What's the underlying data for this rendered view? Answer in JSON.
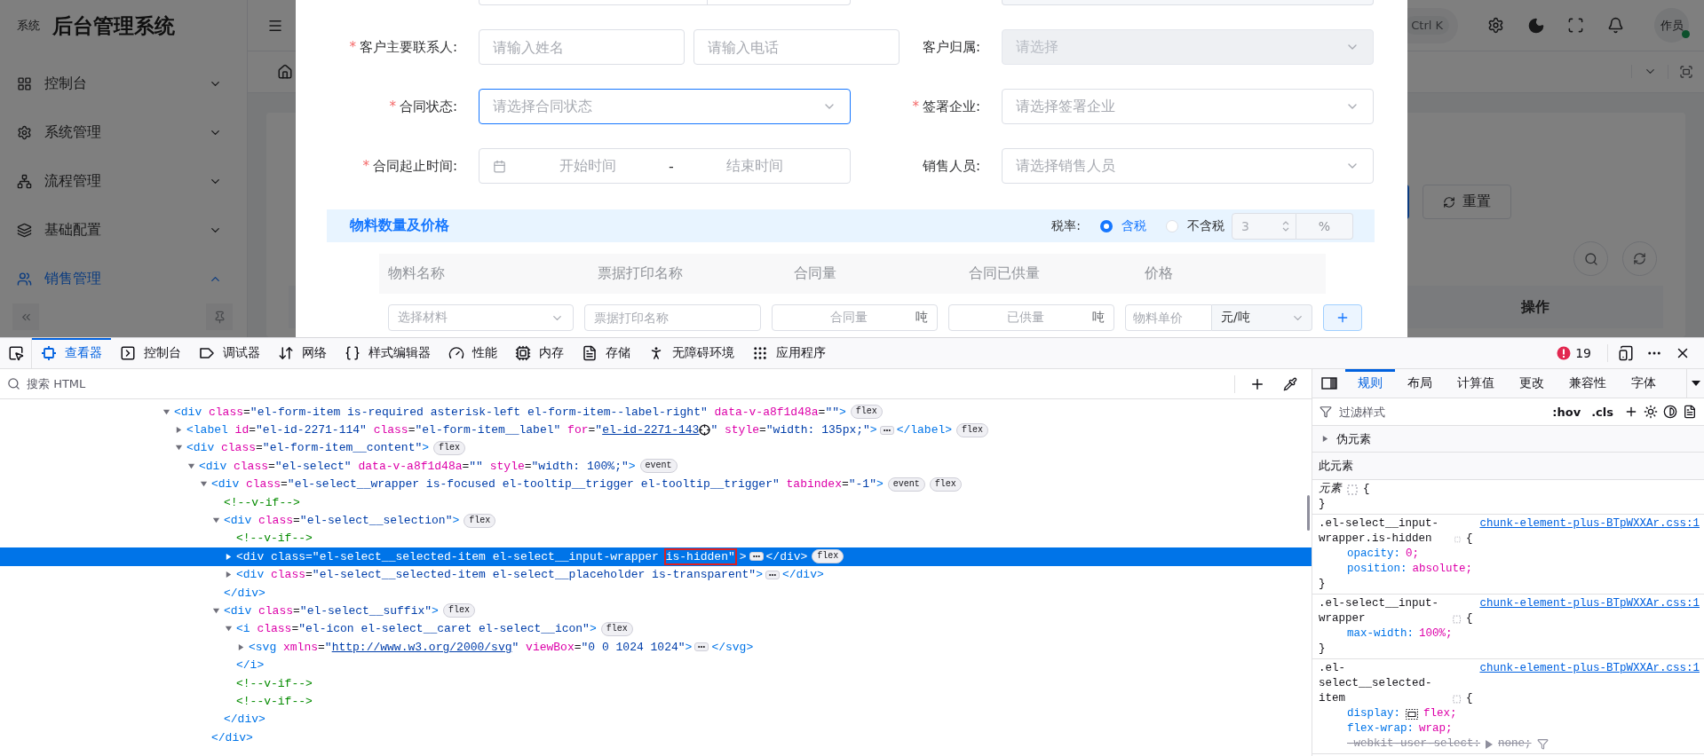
{
  "app": {
    "brand_small": "系统",
    "brand": "后台管理系统",
    "menu": [
      {
        "label": "控制台",
        "expanded": false
      },
      {
        "label": "系统管理",
        "expanded": false
      },
      {
        "label": "流程管理",
        "expanded": false
      },
      {
        "label": "基础配置",
        "expanded": false
      },
      {
        "label": "销售管理",
        "expanded": true
      }
    ],
    "shortcut": "Ctrl K",
    "avatar": "作员",
    "reset_button": "重置",
    "action_column": "操作"
  },
  "dialog": {
    "fields": [
      {
        "asterisk": "*",
        "label": "客户主要联系人:",
        "kind": "pair",
        "placeholders": [
          "请输入姓名",
          "请输入电话"
        ],
        "focused": false,
        "disabled": false
      },
      {
        "label": "客户归属:",
        "kind": "select",
        "placeholder": "请选择",
        "focused": false,
        "disabled": true
      },
      {
        "asterisk": "*",
        "label": "合同状态:",
        "kind": "select",
        "placeholder": "请选择合同状态",
        "focused": true,
        "disabled": false
      },
      {
        "asterisk": "*",
        "label": "签署企业:",
        "kind": "select",
        "placeholder": "请选择签署企业",
        "focused": false,
        "disabled": false
      },
      {
        "asterisk": "*",
        "label": "合同起止时间:",
        "kind": "daterange",
        "start": "开始时间",
        "separator": "-",
        "end": "结束时间",
        "focused": false,
        "disabled": false
      },
      {
        "label": "销售人员:",
        "kind": "select",
        "placeholder": "请选择销售人员",
        "focused": false,
        "disabled": false
      }
    ],
    "section": {
      "title": "物料数量及价格",
      "tax_label": "税率:",
      "options": [
        {
          "label": "含税",
          "selected": true
        },
        {
          "label": "不含税",
          "selected": false
        }
      ],
      "rate": "3",
      "unit": "%"
    },
    "columns": [
      "物料名称",
      "票据打印名称",
      "合同量",
      "合同已供量",
      "价格"
    ],
    "row": {
      "material": "选择材料",
      "print_name": {
        "placeholder": "票据打印名称"
      },
      "quantity": "合同量",
      "quantity_unit": "吨",
      "supplied": "已供量",
      "supplied_unit": "吨",
      "price": {
        "placeholder": "物料单价"
      },
      "price_unit": "元/吨"
    }
  },
  "devtools": {
    "tabs": [
      {
        "label": "查看器",
        "selected": true
      },
      {
        "label": "控制台",
        "selected": false
      },
      {
        "label": "调试器",
        "selected": false
      },
      {
        "label": "网络",
        "selected": false
      },
      {
        "label": "样式编辑器",
        "selected": false
      },
      {
        "label": "性能",
        "selected": false
      },
      {
        "label": "内存",
        "selected": false
      },
      {
        "label": "存储",
        "selected": false
      },
      {
        "label": "无障碍环境",
        "selected": false
      },
      {
        "label": "应用程序",
        "selected": false
      }
    ],
    "error_count": "19",
    "search_placeholder": "搜索 HTML",
    "tree": [
      {
        "kind": "element",
        "selected": false,
        "expanded": true,
        "parts": [
          {
            "kind": "code",
            "tokens": [
              {
                "kind": "tag",
                "text": "<div"
              },
              {
                "kind": "attr",
                "text": " class"
              },
              {
                "kind": "eq",
                "text": "="
              },
              {
                "kind": "value",
                "text": "\"el-form-item is-required asterisk-left el-form-item--label-right\""
              },
              {
                "kind": "attr",
                "text": " data-v-a8f1d48a"
              },
              {
                "kind": "eq",
                "text": "="
              },
              {
                "kind": "value",
                "text": "\"\""
              },
              {
                "kind": "tag",
                "text": ">"
              }
            ]
          },
          {
            "kind": "badge",
            "text": "flex"
          }
        ],
        "children": [
          {
            "kind": "element",
            "selected": false,
            "expanded": false,
            "parts": [
              {
                "kind": "code",
                "tokens": [
                  {
                    "kind": "tag",
                    "text": "<label"
                  },
                  {
                    "kind": "attr",
                    "text": " id"
                  },
                  {
                    "kind": "eq",
                    "text": "="
                  },
                  {
                    "kind": "value",
                    "text": "\"el-id-2271-114\""
                  },
                  {
                    "kind": "attr",
                    "text": " class"
                  },
                  {
                    "kind": "eq",
                    "text": "="
                  },
                  {
                    "kind": "value",
                    "text": "\"el-form-item__label\""
                  },
                  {
                    "kind": "attr",
                    "text": " for"
                  },
                  {
                    "kind": "eq",
                    "text": "="
                  },
                  {
                    "kind": "value",
                    "text": "\""
                  }
                ]
              },
              {
                "kind": "link",
                "text": "el-id-2271-143"
              },
              {
                "kind": "target"
              },
              {
                "kind": "code",
                "tokens": [
                  {
                    "kind": "value",
                    "text": "\""
                  },
                  {
                    "kind": "attr",
                    "text": " style"
                  },
                  {
                    "kind": "eq",
                    "text": "="
                  },
                  {
                    "kind": "value",
                    "text": "\"width: 135px;\""
                  },
                  {
                    "kind": "tag",
                    "text": ">"
                  }
                ]
              },
              {
                "kind": "more"
              },
              {
                "kind": "code",
                "tokens": [
                  {
                    "kind": "tag",
                    "text": "</label>"
                  }
                ]
              },
              {
                "kind": "badge",
                "text": "flex"
              }
            ]
          },
          {
            "kind": "element",
            "selected": false,
            "expanded": true,
            "parts": [
              {
                "kind": "code",
                "tokens": [
                  {
                    "kind": "tag",
                    "text": "<div"
                  },
                  {
                    "kind": "attr",
                    "text": " class"
                  },
                  {
                    "kind": "eq",
                    "text": "="
                  },
                  {
                    "kind": "value",
                    "text": "\"el-form-item__content\""
                  },
                  {
                    "kind": "tag",
                    "text": ">"
                  }
                ]
              },
              {
                "kind": "badge",
                "text": "flex"
              }
            ],
            "children": [
              {
                "kind": "element",
                "selected": false,
                "expanded": true,
                "parts": [
                  {
                    "kind": "code",
                    "tokens": [
                      {
                        "kind": "tag",
                        "text": "<div"
                      },
                      {
                        "kind": "attr",
                        "text": " class"
                      },
                      {
                        "kind": "eq",
                        "text": "="
                      },
                      {
                        "kind": "value",
                        "text": "\"el-select\""
                      },
                      {
                        "kind": "attr",
                        "text": " data-v-a8f1d48a"
                      },
                      {
                        "kind": "eq",
                        "text": "="
                      },
                      {
                        "kind": "value",
                        "text": "\"\""
                      },
                      {
                        "kind": "attr",
                        "text": " style"
                      },
                      {
                        "kind": "eq",
                        "text": "="
                      },
                      {
                        "kind": "value",
                        "text": "\"width: 100%;\""
                      },
                      {
                        "kind": "tag",
                        "text": ">"
                      }
                    ]
                  },
                  {
                    "kind": "badge",
                    "text": "event"
                  }
                ],
                "children": [
                  {
                    "kind": "element",
                    "selected": false,
                    "expanded": true,
                    "parts": [
                      {
                        "kind": "code",
                        "tokens": [
                          {
                            "kind": "tag",
                            "text": "<div"
                          },
                          {
                            "kind": "attr",
                            "text": " class"
                          },
                          {
                            "kind": "eq",
                            "text": "="
                          },
                          {
                            "kind": "value",
                            "text": "\"el-select__wrapper is-focused el-tooltip__trigger el-tooltip__trigger\""
                          },
                          {
                            "kind": "attr",
                            "text": " tabindex"
                          },
                          {
                            "kind": "eq",
                            "text": "="
                          },
                          {
                            "kind": "value",
                            "text": "\"-1\""
                          },
                          {
                            "kind": "tag",
                            "text": ">"
                          }
                        ]
                      },
                      {
                        "kind": "badge",
                        "text": "event"
                      },
                      {
                        "kind": "badge",
                        "text": "flex"
                      }
                    ],
                    "closing": [
                      {
                        "kind": "tag",
                        "text": "</div>"
                      }
                    ],
                    "children": [
                      {
                        "kind": "comment",
                        "selected": false,
                        "parts": [
                          {
                            "kind": "code",
                            "tokens": [
                              {
                                "kind": "comment",
                                "text": "<!--v-if-->"
                              }
                            ]
                          }
                        ]
                      },
                      {
                        "kind": "element",
                        "selected": false,
                        "expanded": true,
                        "parts": [
                          {
                            "kind": "code",
                            "tokens": [
                              {
                                "kind": "tag",
                                "text": "<div"
                              },
                              {
                                "kind": "attr",
                                "text": " class"
                              },
                              {
                                "kind": "eq",
                                "text": "="
                              },
                              {
                                "kind": "value",
                                "text": "\"el-select__selection\""
                              },
                              {
                                "kind": "tag",
                                "text": ">"
                              }
                            ]
                          },
                          {
                            "kind": "badge",
                            "text": "flex"
                          }
                        ],
                        "closing": [
                          {
                            "kind": "tag",
                            "text": "</div>"
                          }
                        ],
                        "children": [
                          {
                            "kind": "comment",
                            "selected": false,
                            "parts": [
                              {
                                "kind": "code",
                                "tokens": [
                                  {
                                    "kind": "comment",
                                    "text": "<!--v-if-->"
                                  }
                                ]
                              }
                            ]
                          },
                          {
                            "kind": "element",
                            "selected": true,
                            "expanded": false,
                            "parts": [
                              {
                                "kind": "code",
                                "tokens": [
                                  {
                                    "kind": "tag",
                                    "text": "<div"
                                  },
                                  {
                                    "kind": "attr",
                                    "text": " class"
                                  },
                                  {
                                    "kind": "eq",
                                    "text": "="
                                  },
                                  {
                                    "kind": "value",
                                    "text": "\"el-select__selected-item el-select__input-wrapper "
                                  }
                                ]
                              },
                              {
                                "kind": "boxed",
                                "tokens": [
                                  {
                                    "kind": "value",
                                    "text": "is-hidden\""
                                  }
                                ]
                              },
                              {
                                "kind": "code",
                                "tokens": [
                                  {
                                    "kind": "tag",
                                    "text": ">"
                                  }
                                ]
                              },
                              {
                                "kind": "more"
                              },
                              {
                                "kind": "code",
                                "tokens": [
                                  {
                                    "kind": "tag",
                                    "text": "</div>"
                                  }
                                ]
                              },
                              {
                                "kind": "badge",
                                "text": "flex"
                              }
                            ]
                          },
                          {
                            "kind": "element",
                            "selected": false,
                            "expanded": false,
                            "parts": [
                              {
                                "kind": "code",
                                "tokens": [
                                  {
                                    "kind": "tag",
                                    "text": "<div"
                                  },
                                  {
                                    "kind": "attr",
                                    "text": " class"
                                  },
                                  {
                                    "kind": "eq",
                                    "text": "="
                                  },
                                  {
                                    "kind": "value",
                                    "text": "\"el-select__selected-item el-select__placeholder is-transparent\""
                                  },
                                  {
                                    "kind": "tag",
                                    "text": ">"
                                  }
                                ]
                              },
                              {
                                "kind": "more"
                              },
                              {
                                "kind": "code",
                                "tokens": [
                                  {
                                    "kind": "tag",
                                    "text": "</div>"
                                  }
                                ]
                              }
                            ]
                          }
                        ]
                      },
                      {
                        "kind": "element",
                        "selected": false,
                        "expanded": true,
                        "parts": [
                          {
                            "kind": "code",
                            "tokens": [
                              {
                                "kind": "tag",
                                "text": "<div"
                              },
                              {
                                "kind": "attr",
                                "text": " class"
                              },
                              {
                                "kind": "eq",
                                "text": "="
                              },
                              {
                                "kind": "value",
                                "text": "\"el-select__suffix\""
                              },
                              {
                                "kind": "tag",
                                "text": ">"
                              }
                            ]
                          },
                          {
                            "kind": "badge",
                            "text": "flex"
                          }
                        ],
                        "closing": [
                          {
                            "kind": "tag",
                            "text": "</div>"
                          }
                        ],
                        "children": [
                          {
                            "kind": "element",
                            "selected": false,
                            "expanded": true,
                            "parts": [
                              {
                                "kind": "code",
                                "tokens": [
                                  {
                                    "kind": "tag",
                                    "text": "<i"
                                  },
                                  {
                                    "kind": "attr",
                                    "text": " class"
                                  },
                                  {
                                    "kind": "eq",
                                    "text": "="
                                  },
                                  {
                                    "kind": "value",
                                    "text": "\"el-icon el-select__caret el-select__icon\""
                                  },
                                  {
                                    "kind": "tag",
                                    "text": ">"
                                  }
                                ]
                              },
                              {
                                "kind": "badge",
                                "text": "flex"
                              }
                            ],
                            "closing": [
                              {
                                "kind": "tag",
                                "text": "</i>"
                              }
                            ],
                            "children": [
                              {
                                "kind": "element",
                                "selected": false,
                                "expanded": false,
                                "parts": [
                                  {
                                    "kind": "code",
                                    "tokens": [
                                      {
                                        "kind": "tag",
                                        "text": "<svg"
                                      },
                                      {
                                        "kind": "attr",
                                        "text": " xmlns"
                                      },
                                      {
                                        "kind": "eq",
                                        "text": "="
                                      },
                                      {
                                        "kind": "value",
                                        "text": "\""
                                      }
                                    ]
                                  },
                                  {
                                    "kind": "link",
                                    "text": "http://www.w3.org/2000/svg"
                                  },
                                  {
                                    "kind": "code",
                                    "tokens": [
                                      {
                                        "kind": "value",
                                        "text": "\""
                                      },
                                      {
                                        "kind": "attr",
                                        "text": " viewBox"
                                      },
                                      {
                                        "kind": "eq",
                                        "text": "="
                                      },
                                      {
                                        "kind": "value",
                                        "text": "\"0 0 1024 1024\""
                                      },
                                      {
                                        "kind": "tag",
                                        "text": ">"
                                      }
                                    ]
                                  },
                                  {
                                    "kind": "more"
                                  },
                                  {
                                    "kind": "code",
                                    "tokens": [
                                      {
                                        "kind": "tag",
                                        "text": "</svg>"
                                      }
                                    ]
                                  }
                                ]
                              }
                            ]
                          },
                          {
                            "kind": "comment",
                            "selected": false,
                            "parts": [
                              {
                                "kind": "code",
                                "tokens": [
                                  {
                                    "kind": "comment",
                                    "text": "<!--v-if-->"
                                  }
                                ]
                              }
                            ]
                          },
                          {
                            "kind": "comment",
                            "selected": false,
                            "parts": [
                              {
                                "kind": "code",
                                "tokens": [
                                  {
                                    "kind": "comment",
                                    "text": "<!--v-if-->"
                                  }
                                ]
                              }
                            ]
                          }
                        ]
                      }
                    ]
                  }
                ]
              }
            ]
          }
        ]
      }
    ],
    "side_tabs": [
      {
        "label": "规则",
        "selected": true
      },
      {
        "label": "布局",
        "selected": false
      },
      {
        "label": "计算值",
        "selected": false
      },
      {
        "label": "更改",
        "selected": false
      },
      {
        "label": "兼容性",
        "selected": false
      },
      {
        "label": "字体",
        "selected": false
      }
    ],
    "filter_placeholder": "过滤样式",
    "hov": ":hov",
    "cls": ".cls",
    "pseudo": "伪元素",
    "this_element": "此元素",
    "rules": [
      {
        "kind": "element",
        "selector": "元素",
        "open": "{",
        "close": "}"
      },
      {
        "kind": "stylesheet",
        "selector": ".el-select__input-wrapper.is-hidden",
        "source": "chunk-element-plus-BTpWXXAr.css:1",
        "open": "{",
        "close": "}",
        "declarations": [
          {
            "kind": "plain",
            "property": "opacity:",
            "value": "0;"
          },
          {
            "kind": "plain",
            "property": "position:",
            "value": "absolute;"
          }
        ]
      },
      {
        "kind": "stylesheet",
        "selector": ".el-select__input-wrapper",
        "source": "chunk-element-plus-BTpWXXAr.css:1",
        "open": "{",
        "close": "}",
        "declarations": [
          {
            "kind": "plain",
            "property": "max-width:",
            "value": "100%;"
          }
        ]
      },
      {
        "kind": "stylesheet",
        "selector": ".el-select__selected-item",
        "source": "chunk-element-plus-BTpWXXAr.css:1",
        "open": "{",
        "declarations": [
          {
            "kind": "display",
            "property": "display:",
            "value": "flex;"
          },
          {
            "kind": "plain",
            "property": "flex-wrap:",
            "value": "wrap;"
          },
          {
            "kind": "overridden",
            "property": "-webkit-user-select:",
            "value": "none;"
          }
        ]
      }
    ]
  }
}
